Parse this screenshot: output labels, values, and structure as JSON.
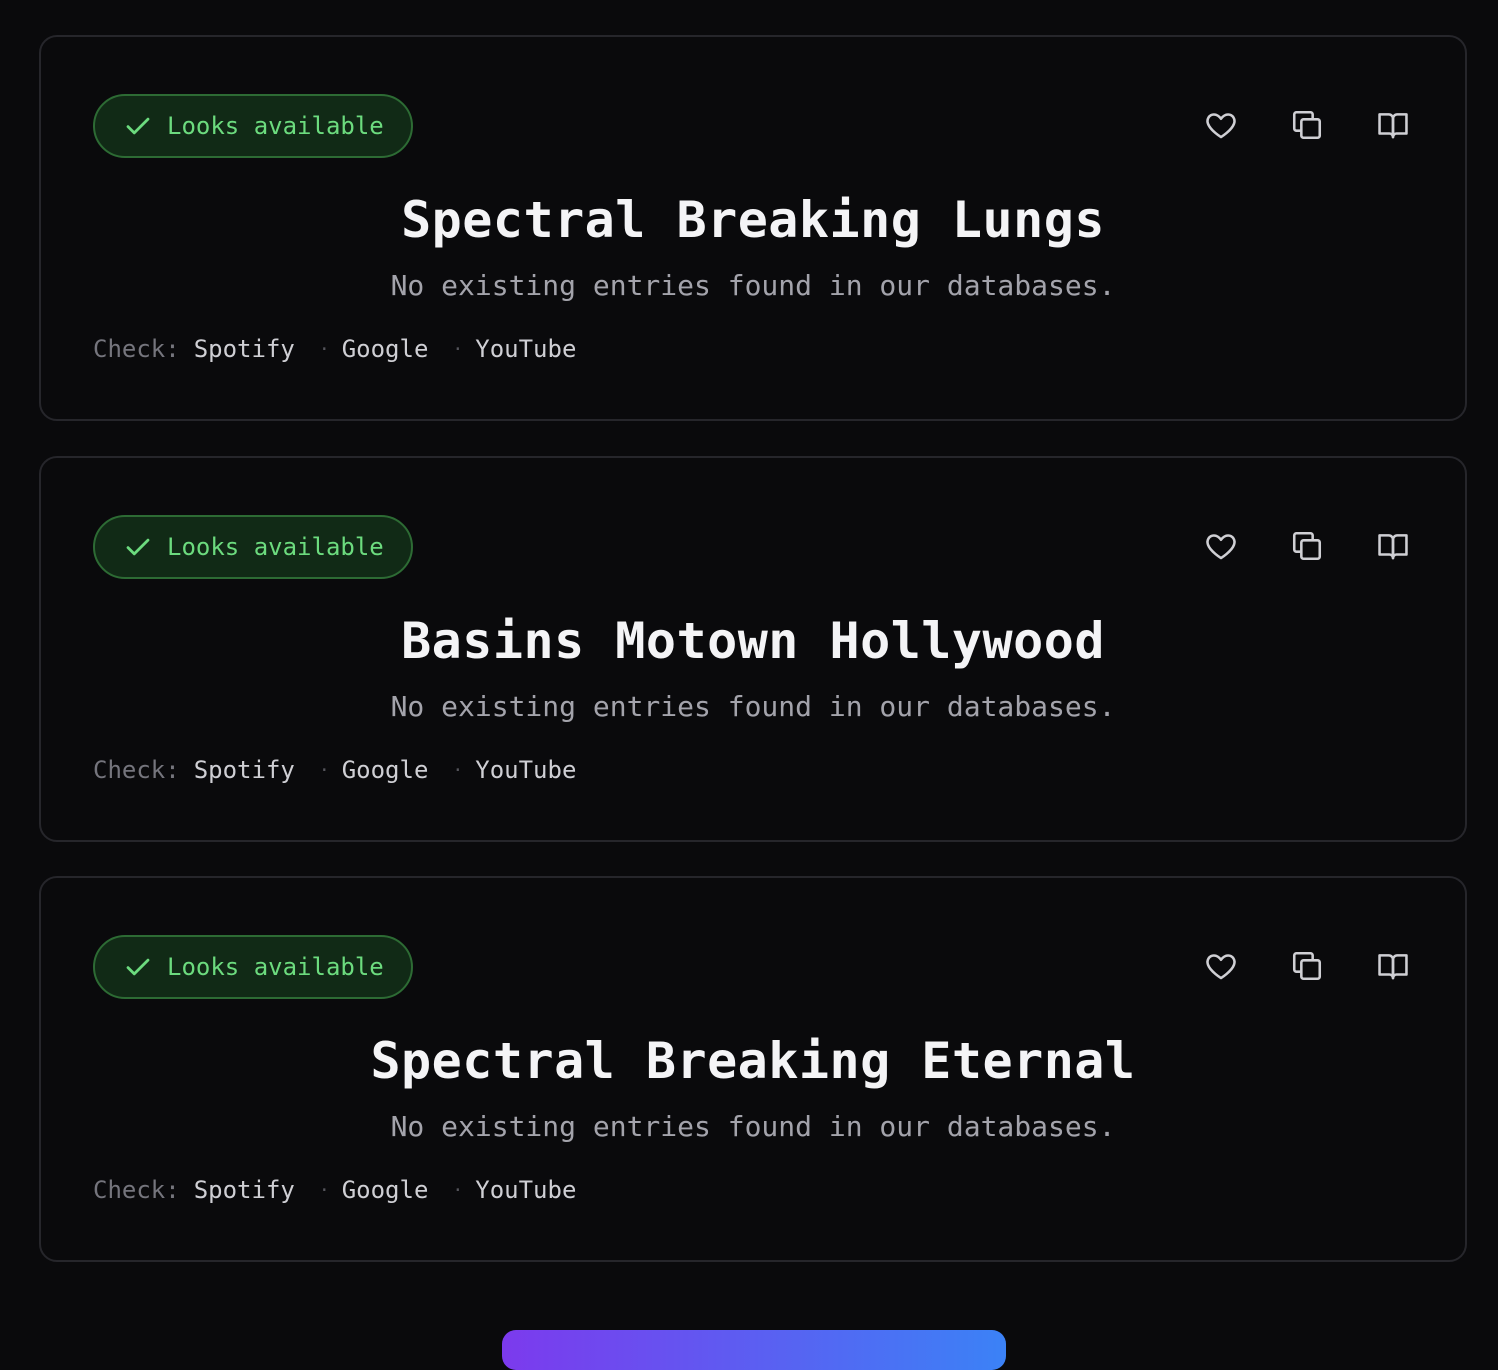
{
  "results": [
    {
      "status_label": "Looks available",
      "name": "Spectral Breaking Lungs",
      "message": "No existing entries found in our databases.",
      "check_label": "Check:",
      "links": [
        "Spotify",
        "Google",
        "YouTube"
      ]
    },
    {
      "status_label": "Looks available",
      "name": "Basins Motown Hollywood",
      "message": "No existing entries found in our databases.",
      "check_label": "Check:",
      "links": [
        "Spotify",
        "Google",
        "YouTube"
      ]
    },
    {
      "status_label": "Looks available",
      "name": "Spectral Breaking Eternal",
      "message": "No existing entries found in our databases.",
      "check_label": "Check:",
      "links": [
        "Spotify",
        "Google",
        "YouTube"
      ]
    }
  ],
  "separator": "·",
  "icons": {
    "status": "check-icon",
    "favorite": "heart-icon",
    "copy": "copy-icon",
    "dictionary": "book-open-icon"
  },
  "colors": {
    "background": "#0a0a0c",
    "card_border": "#26262b",
    "badge_bg": "#112a16",
    "badge_border": "#2d6b34",
    "badge_text": "#6cdb7e",
    "title": "#f4f4f6",
    "subtitle": "#a3a3ab"
  }
}
